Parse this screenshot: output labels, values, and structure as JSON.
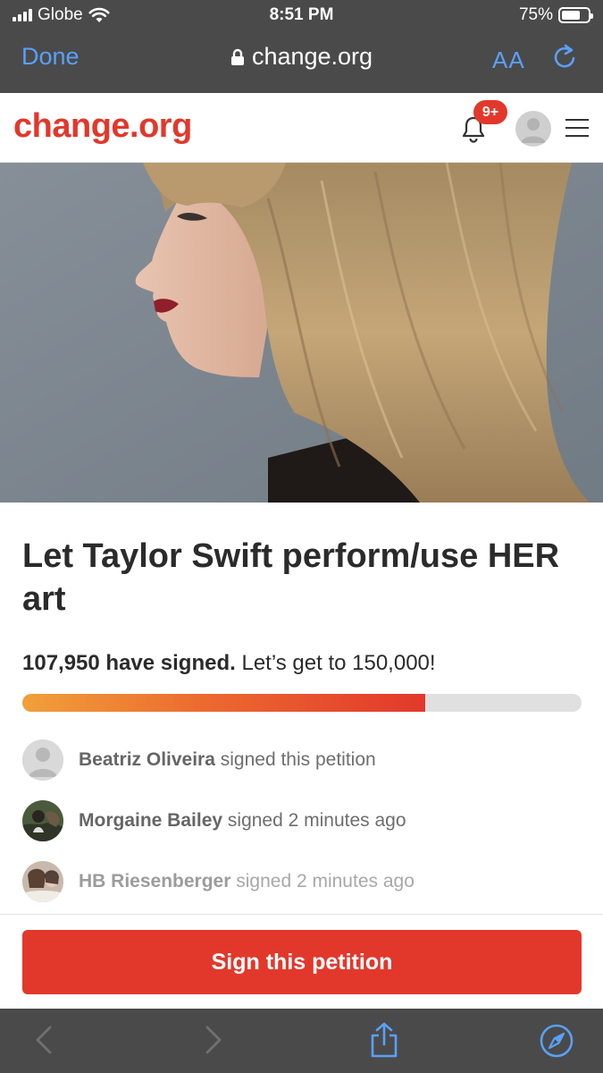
{
  "status_bar": {
    "carrier": "Globe",
    "time": "8:51 PM",
    "battery": "75%",
    "battery_level": 0.75
  },
  "browser": {
    "done_label": "Done",
    "url": "change.org",
    "text_size_label": "AA"
  },
  "site": {
    "logo": "change.org",
    "notification_count": "9+"
  },
  "petition": {
    "title": "Let Taylor Swift perform/use HER art",
    "signed_count": "107,950 have signed.",
    "goal_text": "Let’s get to 150,000!",
    "progress_fraction": 0.7197,
    "sign_button_label": "Sign this petition"
  },
  "signers": [
    {
      "name": "Beatriz Oliveira",
      "action": "signed this petition",
      "avatar": "default-avatar"
    },
    {
      "name": "Morgaine Bailey",
      "action": "signed 2 minutes ago",
      "avatar": "photo-avatar"
    },
    {
      "name": "HB Riesenberger",
      "action": "signed 2 minutes ago",
      "avatar": "photo-avatar"
    }
  ],
  "colors": {
    "brand_red": "#e2382b",
    "ios_blue": "#5aa0f7",
    "chrome_dark": "#4a4a4a",
    "progress_start": "#f0a03a"
  },
  "icons": {
    "lock": "lock-icon",
    "reload": "reload-icon",
    "bell": "bell-icon",
    "menu": "hamburger-menu-icon",
    "back": "chevron-left-icon",
    "forward": "chevron-right-icon",
    "share": "share-icon",
    "compass": "compass-icon"
  }
}
